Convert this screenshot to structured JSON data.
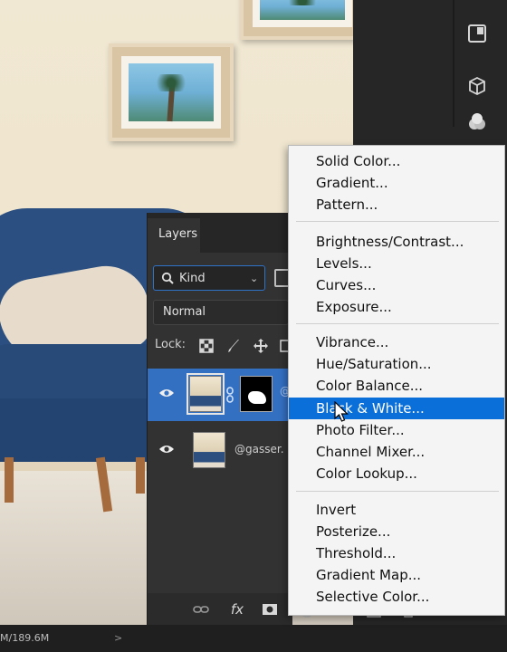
{
  "layers_panel": {
    "tab_label": "Layers",
    "filter": {
      "label": "Kind"
    },
    "blend_mode": "Normal",
    "lock_label": "Lock:",
    "layers": [
      {
        "name": "@",
        "selected": true,
        "has_mask": true
      },
      {
        "name": "@gasser.",
        "selected": false,
        "has_mask": false
      }
    ],
    "footer_icons": [
      "link-icon",
      "fx-icon",
      "mask-icon",
      "adjustment-icon",
      "group-icon",
      "new-layer-icon",
      "trash-icon"
    ],
    "fx_label": "fx"
  },
  "status_bar": {
    "doc_size": "M/189.6M",
    "arrow": ">"
  },
  "adjustment_menu": {
    "groups": [
      [
        "Solid Color...",
        "Gradient...",
        "Pattern..."
      ],
      [
        "Brightness/Contrast...",
        "Levels...",
        "Curves...",
        "Exposure..."
      ],
      [
        "Vibrance...",
        "Hue/Saturation...",
        "Color Balance...",
        "Black & White...",
        "Photo Filter...",
        "Channel Mixer...",
        "Color Lookup..."
      ],
      [
        "Invert",
        "Posterize...",
        "Threshold...",
        "Gradient Map...",
        "Selective Color..."
      ]
    ],
    "highlighted": "Black & White...",
    "highlight_color": "#0a6fd8"
  },
  "right_strip_icons": [
    "panel-icon",
    "cube-icon",
    "channels-icon"
  ],
  "colors": {
    "panel_bg": "#323232",
    "selection_blue": "#3470c2",
    "menu_bg": "#f4f4f4"
  }
}
